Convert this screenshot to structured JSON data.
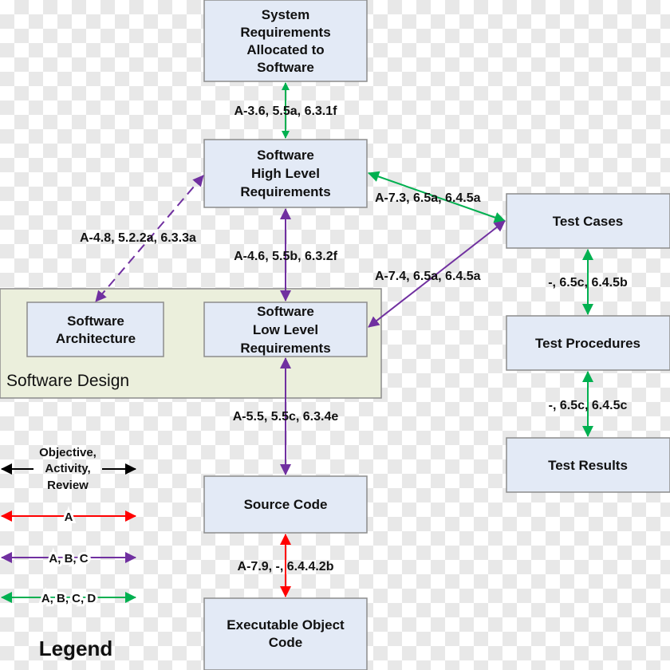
{
  "colors": {
    "objective": "#000000",
    "a": "#ff0000",
    "abc": "#7030a0",
    "abcd": "#00b050",
    "box_fill": "#e3eaf6",
    "design_fill": "#ebefdc"
  },
  "boxes": {
    "system_req": [
      "System",
      "Requirements",
      "Allocated to",
      "Software"
    ],
    "hlr": [
      "Software",
      "High Level",
      "Requirements"
    ],
    "arch": [
      "Software",
      "Architecture"
    ],
    "llr": [
      "Software",
      "Low Level",
      "Requirements"
    ],
    "source": "Source Code",
    "exec": [
      "Executable Object",
      "Code"
    ],
    "test_cases": "Test Cases",
    "test_procedures": "Test Procedures",
    "test_results": "Test Results"
  },
  "design_group_label": "Software Design",
  "arrows": {
    "sys_hlr": "A-3.6, 5.5a, 6.3.1f",
    "hlr_tc": "A-7.3, 6.5a, 6.4.5a",
    "hlr_arch": "A-4.8, 5.2.2a, 6.3.3a",
    "hlr_llr": "A-4.6, 5.5b, 6.3.2f",
    "llr_tc": "A-7.4, 6.5a, 6.4.5a",
    "llr_src": "A-5.5, 5.5c, 6.3.4e",
    "src_exec": "A-7.9, -, 6.4.4.2b",
    "tc_tp": "-, 6.5c, 6.4.5b",
    "tp_tr": "-, 6.5c, 6.4.5c"
  },
  "legend": {
    "title": "Legend",
    "objective": [
      "Objective,",
      "Activity,",
      "Review"
    ],
    "a": "A",
    "abc": "A, B, C",
    "abcd": "A, B, C, D"
  }
}
